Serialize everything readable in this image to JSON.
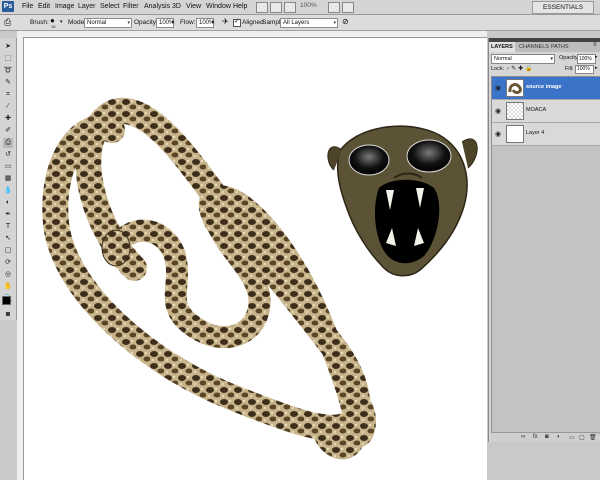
{
  "app": {
    "logo": "Ps",
    "menu": [
      "File",
      "Edit",
      "Image",
      "Layer",
      "Select",
      "Filter",
      "Analysis",
      "3D",
      "View",
      "Window",
      "Help"
    ],
    "zoom": "100%",
    "workspace": "ESSENTIALS"
  },
  "options_bar": {
    "brush_label": "Brush:",
    "brush_size": "15",
    "mode_label": "Mode:",
    "mode_value": "Normal",
    "opacity_label": "Opacity:",
    "opacity_value": "100%",
    "flow_label": "Flow:",
    "flow_value": "100%",
    "aligned_label": "Aligned",
    "aligned_checked": true,
    "sample_label": "Sample:",
    "sample_value": "All Layers"
  },
  "layers_panel": {
    "tabs": [
      "LAYERS",
      "CHANNELS",
      "PATHS"
    ],
    "active_tab": "LAYERS",
    "blend_mode": "Normal",
    "opacity_label": "Opacity:",
    "opacity_value": "100%",
    "lock_label": "Lock:",
    "fill_label": "Fill:",
    "fill_value": "100%",
    "layers": [
      {
        "name": "source image",
        "selected": true
      },
      {
        "name": "MOACA",
        "selected": false
      },
      {
        "name": "Layer 4",
        "selected": false
      }
    ]
  },
  "colors": {
    "selection": "#3b73c8",
    "menu_bg": "#d4d4d4",
    "canvas": "#ffffff"
  }
}
